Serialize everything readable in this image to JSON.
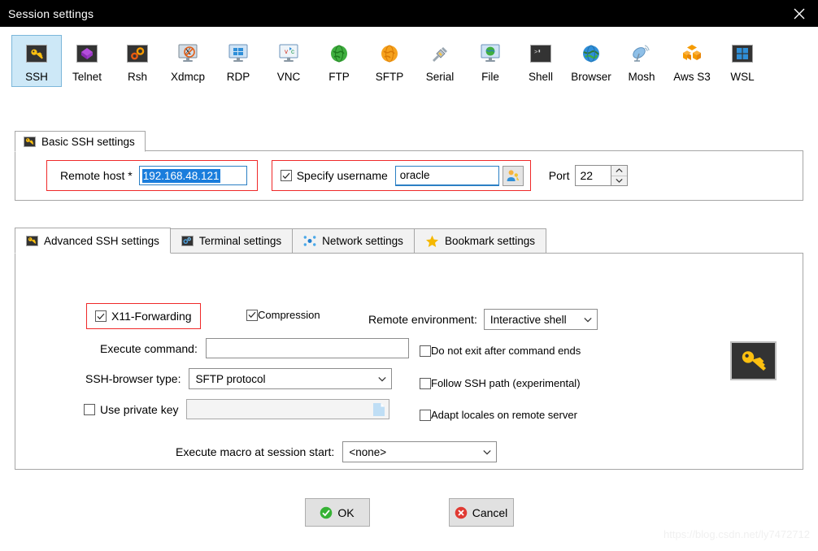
{
  "window": {
    "title": "Session settings",
    "close_icon": "close-icon"
  },
  "session_types": [
    {
      "label": "SSH",
      "icon": "ssh-key-icon",
      "selected": true
    },
    {
      "label": "Telnet",
      "icon": "telnet-cube-icon",
      "selected": false
    },
    {
      "label": "Rsh",
      "icon": "rsh-gears-icon",
      "selected": false
    },
    {
      "label": "Xdmcp",
      "icon": "xdmcp-monitor-icon",
      "selected": false
    },
    {
      "label": "RDP",
      "icon": "rdp-monitor-icon",
      "selected": false
    },
    {
      "label": "VNC",
      "icon": "vnc-monitor-icon",
      "selected": false
    },
    {
      "label": "FTP",
      "icon": "ftp-globe-icon",
      "selected": false
    },
    {
      "label": "SFTP",
      "icon": "sftp-globe-icon",
      "selected": false
    },
    {
      "label": "Serial",
      "icon": "serial-plug-icon",
      "selected": false
    },
    {
      "label": "File",
      "icon": "file-monitor-icon",
      "selected": false
    },
    {
      "label": "Shell",
      "icon": "shell-terminal-icon",
      "selected": false
    },
    {
      "label": "Browser",
      "icon": "browser-globe-icon",
      "selected": false
    },
    {
      "label": "Mosh",
      "icon": "mosh-dish-icon",
      "selected": false
    },
    {
      "label": "Aws S3",
      "icon": "aws-s3-cubes-icon",
      "selected": false
    },
    {
      "label": "WSL",
      "icon": "wsl-windows-icon",
      "selected": false
    }
  ],
  "basic": {
    "group_title": "Basic SSH settings",
    "group_icon": "ssh-key-icon",
    "remote_host_label": "Remote host *",
    "remote_host_value": "192.168.48.121",
    "remote_host_selected": true,
    "specify_username_label": "Specify username",
    "specify_username_checked": true,
    "username_value": "oracle",
    "username_pick_icon": "user-key-icon",
    "port_label": "Port",
    "port_value": "22",
    "spin_up_icon": "chevron-up-icon",
    "spin_down_icon": "chevron-down-icon"
  },
  "advanced": {
    "tabs": [
      {
        "label": "Advanced SSH settings",
        "icon": "ssh-key-icon",
        "active": true
      },
      {
        "label": "Terminal settings",
        "icon": "terminal-gear-icon",
        "active": false
      },
      {
        "label": "Network settings",
        "icon": "network-dots-icon",
        "active": false
      },
      {
        "label": "Bookmark settings",
        "icon": "star-icon",
        "active": false
      }
    ],
    "x11_forwarding_label": "X11-Forwarding",
    "x11_forwarding_checked": true,
    "compression_label": "Compression",
    "compression_checked": true,
    "remote_environment_label": "Remote environment:",
    "remote_environment_value": "Interactive shell",
    "execute_command_label": "Execute command:",
    "execute_command_value": "",
    "ssh_browser_label": "SSH-browser type:",
    "ssh_browser_value": "SFTP protocol",
    "use_private_key_label": "Use private key",
    "use_private_key_checked": false,
    "private_key_value": "",
    "private_key_browse_icon": "file-document-icon",
    "do_not_exit_label": "Do not exit after command ends",
    "do_not_exit_checked": false,
    "follow_ssh_path_label": "Follow SSH path (experimental)",
    "follow_ssh_path_checked": false,
    "adapt_locales_label": "Adapt locales on remote server",
    "adapt_locales_checked": false,
    "key_badge_icon": "ssh-key-icon",
    "execute_macro_label": "Execute macro at session start:",
    "execute_macro_value": "<none>",
    "dropdown_icon": "chevron-down-icon"
  },
  "buttons": {
    "ok_label": "OK",
    "ok_icon": "check-circle-icon",
    "cancel_label": "Cancel",
    "cancel_icon": "x-circle-icon"
  },
  "watermark": "https://blog.csdn.net/ly7472712",
  "colors": {
    "titlebar_bg": "#000000",
    "selected_tab_bg": "#cde8f7",
    "selected_tab_border": "#7cb7da",
    "highlight_red": "#ef2929",
    "focus_blue": "#2b7fc4",
    "selection_blue": "#1a7ddc",
    "key_yellow": "#fdc010",
    "ok_green": "#35b234",
    "cancel_red": "#e03a33"
  }
}
